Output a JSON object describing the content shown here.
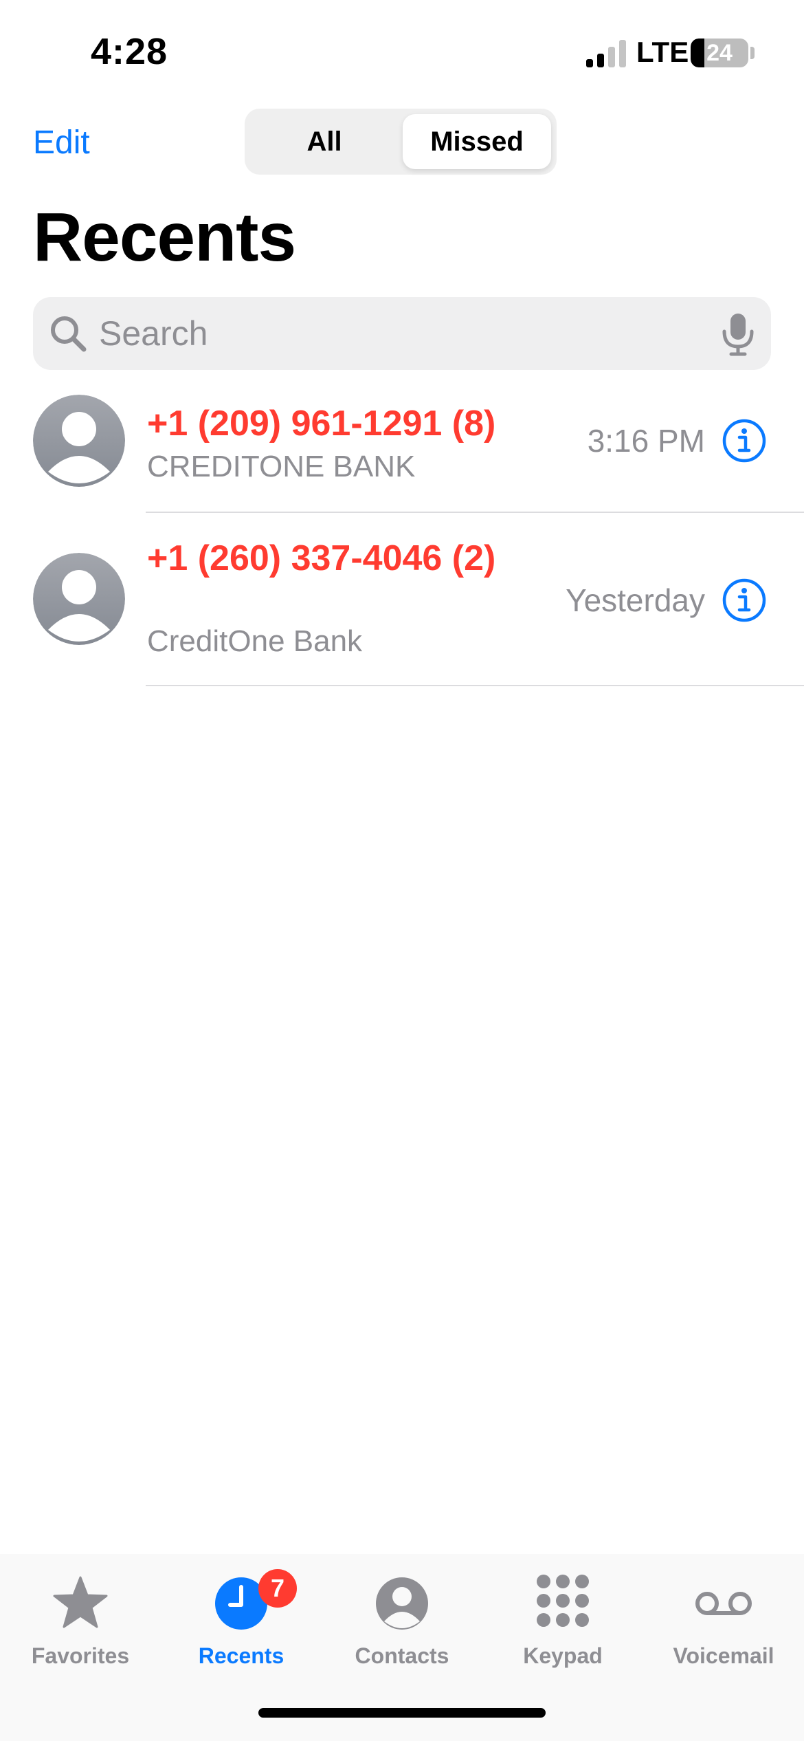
{
  "status_bar": {
    "time": "4:28",
    "network": "LTE",
    "battery_percent": "24",
    "battery_level": 0.24,
    "signal_bars_active": 2,
    "signal_bars_total": 4
  },
  "nav": {
    "edit_label": "Edit",
    "segments": [
      {
        "label": "All",
        "selected": false
      },
      {
        "label": "Missed",
        "selected": true
      }
    ]
  },
  "title": "Recents",
  "search": {
    "placeholder": "Search",
    "value": ""
  },
  "calls": [
    {
      "name": "+1 (209) 961-1291 (8)",
      "label": "CREDITONE BANK",
      "time": "3:16 PM",
      "missed": true
    },
    {
      "name": "+1 (260) 337-4046 (2)",
      "label": "CreditOne Bank",
      "time": "Yesterday",
      "missed": true
    }
  ],
  "tab_bar": {
    "tabs": [
      {
        "label": "Favorites",
        "icon": "star-icon",
        "active": false
      },
      {
        "label": "Recents",
        "icon": "clock-icon",
        "active": true,
        "badge": "7"
      },
      {
        "label": "Contacts",
        "icon": "person-circle-icon",
        "active": false
      },
      {
        "label": "Keypad",
        "icon": "keypad-icon",
        "active": false
      },
      {
        "label": "Voicemail",
        "icon": "voicemail-icon",
        "active": false
      }
    ]
  },
  "colors": {
    "accent": "#0a7aff",
    "missed": "#ff3b30",
    "secondary_text": "#8e8e93",
    "badge": "#ff3b30"
  }
}
